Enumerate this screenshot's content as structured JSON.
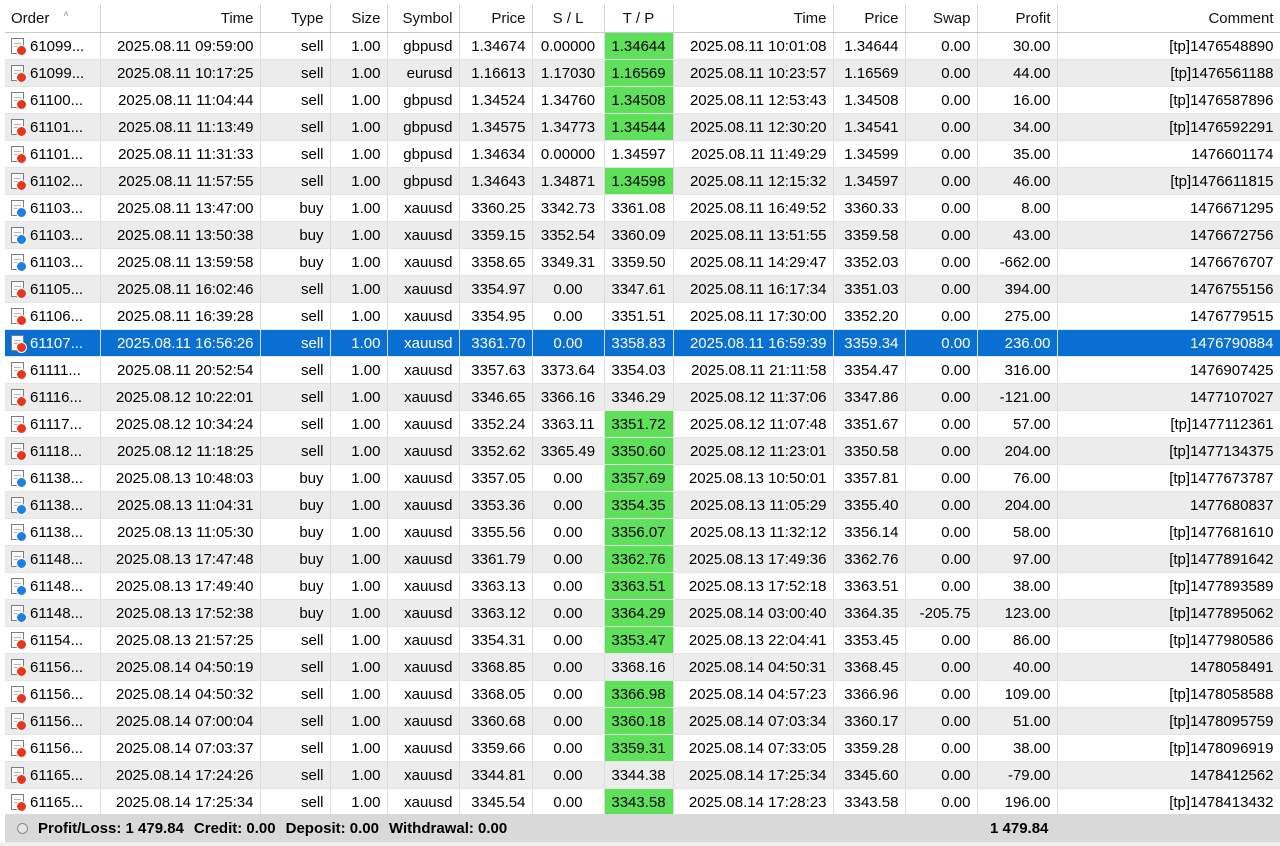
{
  "columns": [
    {
      "label": "Order",
      "align": "left",
      "width": 95
    },
    {
      "label": "Time",
      "align": "right",
      "width": 160
    },
    {
      "label": "Type",
      "align": "right",
      "width": 70
    },
    {
      "label": "Size",
      "align": "right",
      "width": 57
    },
    {
      "label": "Symbol",
      "align": "right",
      "width": 72
    },
    {
      "label": "Price",
      "align": "right",
      "width": 73
    },
    {
      "label": "S / L",
      "align": "center",
      "width": 72
    },
    {
      "label": "T / P",
      "align": "center",
      "width": 69
    },
    {
      "label": "Time",
      "align": "right",
      "width": 160
    },
    {
      "label": "Price",
      "align": "right",
      "width": 72
    },
    {
      "label": "Swap",
      "align": "right",
      "width": 72
    },
    {
      "label": "Profit",
      "align": "right",
      "width": 80
    },
    {
      "label": "Comment",
      "align": "right",
      "width": 223
    }
  ],
  "sort_arrow": "˄",
  "rows": [
    {
      "order": "61099...",
      "open_time": "2025.08.11 09:59:00",
      "type": "sell",
      "size": "1.00",
      "symbol": "gbpusd",
      "open_price": "1.34674",
      "sl": "0.00000",
      "tp": "1.34644",
      "tp_hit": true,
      "close_time": "2025.08.11 10:01:08",
      "close_price": "1.34644",
      "swap": "0.00",
      "profit": "30.00",
      "comment": "[tp]1476548890"
    },
    {
      "order": "61099...",
      "open_time": "2025.08.11 10:17:25",
      "type": "sell",
      "size": "1.00",
      "symbol": "eurusd",
      "open_price": "1.16613",
      "sl": "1.17030",
      "tp": "1.16569",
      "tp_hit": true,
      "close_time": "2025.08.11 10:23:57",
      "close_price": "1.16569",
      "swap": "0.00",
      "profit": "44.00",
      "comment": "[tp]1476561188"
    },
    {
      "order": "61100...",
      "open_time": "2025.08.11 11:04:44",
      "type": "sell",
      "size": "1.00",
      "symbol": "gbpusd",
      "open_price": "1.34524",
      "sl": "1.34760",
      "tp": "1.34508",
      "tp_hit": true,
      "close_time": "2025.08.11 12:53:43",
      "close_price": "1.34508",
      "swap": "0.00",
      "profit": "16.00",
      "comment": "[tp]1476587896"
    },
    {
      "order": "61101...",
      "open_time": "2025.08.11 11:13:49",
      "type": "sell",
      "size": "1.00",
      "symbol": "gbpusd",
      "open_price": "1.34575",
      "sl": "1.34773",
      "tp": "1.34544",
      "tp_hit": true,
      "close_time": "2025.08.11 12:30:20",
      "close_price": "1.34541",
      "swap": "0.00",
      "profit": "34.00",
      "comment": "[tp]1476592291"
    },
    {
      "order": "61101...",
      "open_time": "2025.08.11 11:31:33",
      "type": "sell",
      "size": "1.00",
      "symbol": "gbpusd",
      "open_price": "1.34634",
      "sl": "0.00000",
      "tp": "1.34597",
      "tp_hit": false,
      "close_time": "2025.08.11 11:49:29",
      "close_price": "1.34599",
      "swap": "0.00",
      "profit": "35.00",
      "comment": "1476601174"
    },
    {
      "order": "61102...",
      "open_time": "2025.08.11 11:57:55",
      "type": "sell",
      "size": "1.00",
      "symbol": "gbpusd",
      "open_price": "1.34643",
      "sl": "1.34871",
      "tp": "1.34598",
      "tp_hit": true,
      "close_time": "2025.08.11 12:15:32",
      "close_price": "1.34597",
      "swap": "0.00",
      "profit": "46.00",
      "comment": "[tp]1476611815"
    },
    {
      "order": "61103...",
      "open_time": "2025.08.11 13:47:00",
      "type": "buy",
      "size": "1.00",
      "symbol": "xauusd",
      "open_price": "3360.25",
      "sl": "3342.73",
      "tp": "3361.08",
      "tp_hit": false,
      "close_time": "2025.08.11 16:49:52",
      "close_price": "3360.33",
      "swap": "0.00",
      "profit": "8.00",
      "comment": "1476671295"
    },
    {
      "order": "61103...",
      "open_time": "2025.08.11 13:50:38",
      "type": "buy",
      "size": "1.00",
      "symbol": "xauusd",
      "open_price": "3359.15",
      "sl": "3352.54",
      "tp": "3360.09",
      "tp_hit": false,
      "close_time": "2025.08.11 13:51:55",
      "close_price": "3359.58",
      "swap": "0.00",
      "profit": "43.00",
      "comment": "1476672756"
    },
    {
      "order": "61103...",
      "open_time": "2025.08.11 13:59:58",
      "type": "buy",
      "size": "1.00",
      "symbol": "xauusd",
      "open_price": "3358.65",
      "sl": "3349.31",
      "tp": "3359.50",
      "tp_hit": false,
      "close_time": "2025.08.11 14:29:47",
      "close_price": "3352.03",
      "swap": "0.00",
      "profit": "-662.00",
      "comment": "1476676707"
    },
    {
      "order": "61105...",
      "open_time": "2025.08.11 16:02:46",
      "type": "sell",
      "size": "1.00",
      "symbol": "xauusd",
      "open_price": "3354.97",
      "sl": "0.00",
      "tp": "3347.61",
      "tp_hit": false,
      "close_time": "2025.08.11 16:17:34",
      "close_price": "3351.03",
      "swap": "0.00",
      "profit": "394.00",
      "comment": "1476755156"
    },
    {
      "order": "61106...",
      "open_time": "2025.08.11 16:39:28",
      "type": "sell",
      "size": "1.00",
      "symbol": "xauusd",
      "open_price": "3354.95",
      "sl": "0.00",
      "tp": "3351.51",
      "tp_hit": false,
      "close_time": "2025.08.11 17:30:00",
      "close_price": "3352.20",
      "swap": "0.00",
      "profit": "275.00",
      "comment": "1476779515"
    },
    {
      "order": "61107...",
      "open_time": "2025.08.11 16:56:26",
      "type": "sell",
      "size": "1.00",
      "symbol": "xauusd",
      "open_price": "3361.70",
      "sl": "0.00",
      "tp": "3358.83",
      "tp_hit": false,
      "close_time": "2025.08.11 16:59:39",
      "close_price": "3359.34",
      "swap": "0.00",
      "profit": "236.00",
      "comment": "1476790884",
      "selected": true
    },
    {
      "order": "61111...",
      "open_time": "2025.08.11 20:52:54",
      "type": "sell",
      "size": "1.00",
      "symbol": "xauusd",
      "open_price": "3357.63",
      "sl": "3373.64",
      "tp": "3354.03",
      "tp_hit": false,
      "close_time": "2025.08.11 21:11:58",
      "close_price": "3354.47",
      "swap": "0.00",
      "profit": "316.00",
      "comment": "1476907425"
    },
    {
      "order": "61116...",
      "open_time": "2025.08.12 10:22:01",
      "type": "sell",
      "size": "1.00",
      "symbol": "xauusd",
      "open_price": "3346.65",
      "sl": "3366.16",
      "tp": "3346.29",
      "tp_hit": false,
      "close_time": "2025.08.12 11:37:06",
      "close_price": "3347.86",
      "swap": "0.00",
      "profit": "-121.00",
      "comment": "1477107027"
    },
    {
      "order": "61117...",
      "open_time": "2025.08.12 10:34:24",
      "type": "sell",
      "size": "1.00",
      "symbol": "xauusd",
      "open_price": "3352.24",
      "sl": "3363.11",
      "tp": "3351.72",
      "tp_hit": true,
      "close_time": "2025.08.12 11:07:48",
      "close_price": "3351.67",
      "swap": "0.00",
      "profit": "57.00",
      "comment": "[tp]1477112361"
    },
    {
      "order": "61118...",
      "open_time": "2025.08.12 11:18:25",
      "type": "sell",
      "size": "1.00",
      "symbol": "xauusd",
      "open_price": "3352.62",
      "sl": "3365.49",
      "tp": "3350.60",
      "tp_hit": true,
      "close_time": "2025.08.12 11:23:01",
      "close_price": "3350.58",
      "swap": "0.00",
      "profit": "204.00",
      "comment": "[tp]1477134375"
    },
    {
      "order": "61138...",
      "open_time": "2025.08.13 10:48:03",
      "type": "buy",
      "size": "1.00",
      "symbol": "xauusd",
      "open_price": "3357.05",
      "sl": "0.00",
      "tp": "3357.69",
      "tp_hit": true,
      "close_time": "2025.08.13 10:50:01",
      "close_price": "3357.81",
      "swap": "0.00",
      "profit": "76.00",
      "comment": "[tp]1477673787"
    },
    {
      "order": "61138...",
      "open_time": "2025.08.13 11:04:31",
      "type": "buy",
      "size": "1.00",
      "symbol": "xauusd",
      "open_price": "3353.36",
      "sl": "0.00",
      "tp": "3354.35",
      "tp_hit": true,
      "close_time": "2025.08.13 11:05:29",
      "close_price": "3355.40",
      "swap": "0.00",
      "profit": "204.00",
      "comment": "1477680837"
    },
    {
      "order": "61138...",
      "open_time": "2025.08.13 11:05:30",
      "type": "buy",
      "size": "1.00",
      "symbol": "xauusd",
      "open_price": "3355.56",
      "sl": "0.00",
      "tp": "3356.07",
      "tp_hit": true,
      "close_time": "2025.08.13 11:32:12",
      "close_price": "3356.14",
      "swap": "0.00",
      "profit": "58.00",
      "comment": "[tp]1477681610"
    },
    {
      "order": "61148...",
      "open_time": "2025.08.13 17:47:48",
      "type": "buy",
      "size": "1.00",
      "symbol": "xauusd",
      "open_price": "3361.79",
      "sl": "0.00",
      "tp": "3362.76",
      "tp_hit": true,
      "close_time": "2025.08.13 17:49:36",
      "close_price": "3362.76",
      "swap": "0.00",
      "profit": "97.00",
      "comment": "[tp]1477891642"
    },
    {
      "order": "61148...",
      "open_time": "2025.08.13 17:49:40",
      "type": "buy",
      "size": "1.00",
      "symbol": "xauusd",
      "open_price": "3363.13",
      "sl": "0.00",
      "tp": "3363.51",
      "tp_hit": true,
      "close_time": "2025.08.13 17:52:18",
      "close_price": "3363.51",
      "swap": "0.00",
      "profit": "38.00",
      "comment": "[tp]1477893589"
    },
    {
      "order": "61148...",
      "open_time": "2025.08.13 17:52:38",
      "type": "buy",
      "size": "1.00",
      "symbol": "xauusd",
      "open_price": "3363.12",
      "sl": "0.00",
      "tp": "3364.29",
      "tp_hit": true,
      "close_time": "2025.08.14 03:00:40",
      "close_price": "3364.35",
      "swap": "-205.75",
      "profit": "123.00",
      "comment": "[tp]1477895062"
    },
    {
      "order": "61154...",
      "open_time": "2025.08.13 21:57:25",
      "type": "sell",
      "size": "1.00",
      "symbol": "xauusd",
      "open_price": "3354.31",
      "sl": "0.00",
      "tp": "3353.47",
      "tp_hit": true,
      "close_time": "2025.08.13 22:04:41",
      "close_price": "3353.45",
      "swap": "0.00",
      "profit": "86.00",
      "comment": "[tp]1477980586"
    },
    {
      "order": "61156...",
      "open_time": "2025.08.14 04:50:19",
      "type": "sell",
      "size": "1.00",
      "symbol": "xauusd",
      "open_price": "3368.85",
      "sl": "0.00",
      "tp": "3368.16",
      "tp_hit": false,
      "close_time": "2025.08.14 04:50:31",
      "close_price": "3368.45",
      "swap": "0.00",
      "profit": "40.00",
      "comment": "1478058491"
    },
    {
      "order": "61156...",
      "open_time": "2025.08.14 04:50:32",
      "type": "sell",
      "size": "1.00",
      "symbol": "xauusd",
      "open_price": "3368.05",
      "sl": "0.00",
      "tp": "3366.98",
      "tp_hit": true,
      "close_time": "2025.08.14 04:57:23",
      "close_price": "3366.96",
      "swap": "0.00",
      "profit": "109.00",
      "comment": "[tp]1478058588"
    },
    {
      "order": "61156...",
      "open_time": "2025.08.14 07:00:04",
      "type": "sell",
      "size": "1.00",
      "symbol": "xauusd",
      "open_price": "3360.68",
      "sl": "0.00",
      "tp": "3360.18",
      "tp_hit": true,
      "close_time": "2025.08.14 07:03:34",
      "close_price": "3360.17",
      "swap": "0.00",
      "profit": "51.00",
      "comment": "[tp]1478095759"
    },
    {
      "order": "61156...",
      "open_time": "2025.08.14 07:03:37",
      "type": "sell",
      "size": "1.00",
      "symbol": "xauusd",
      "open_price": "3359.66",
      "sl": "0.00",
      "tp": "3359.31",
      "tp_hit": true,
      "close_time": "2025.08.14 07:33:05",
      "close_price": "3359.28",
      "swap": "0.00",
      "profit": "38.00",
      "comment": "[tp]1478096919"
    },
    {
      "order": "61165...",
      "open_time": "2025.08.14 17:24:26",
      "type": "sell",
      "size": "1.00",
      "symbol": "xauusd",
      "open_price": "3344.81",
      "sl": "0.00",
      "tp": "3344.38",
      "tp_hit": false,
      "close_time": "2025.08.14 17:25:34",
      "close_price": "3345.60",
      "swap": "0.00",
      "profit": "-79.00",
      "comment": "1478412562"
    },
    {
      "order": "61165...",
      "open_time": "2025.08.14 17:25:34",
      "type": "sell",
      "size": "1.00",
      "symbol": "xauusd",
      "open_price": "3345.54",
      "sl": "0.00",
      "tp": "3343.58",
      "tp_hit": true,
      "close_time": "2025.08.14 17:28:23",
      "close_price": "3343.58",
      "swap": "0.00",
      "profit": "196.00",
      "comment": "[tp]1478413432"
    }
  ],
  "summary": {
    "profit_loss": "Profit/Loss: 1 479.84",
    "credit": "Credit: 0.00",
    "deposit": "Deposit: 0.00",
    "withdrawal": "Withdrawal: 0.00",
    "total": "1 479.84"
  },
  "colors": {
    "tp_hit": "#5fe05a",
    "selected_row": "#0a6fd2",
    "alt_row": "#ececec",
    "sell_icon": "#e8361c",
    "buy_icon": "#1d7fe2"
  }
}
